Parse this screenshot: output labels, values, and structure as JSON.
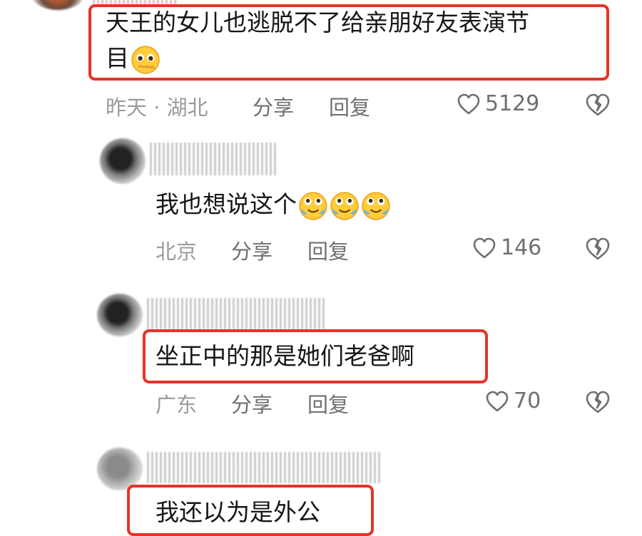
{
  "comments": [
    {
      "text_line1": "天王的女儿也逃脱不了给亲朋好友表演节",
      "text_line2": "目",
      "location": "昨天 · 湖北",
      "share": "分享",
      "reply": "回复",
      "likes": "5129",
      "emoji": "pleading-face-icon"
    },
    {
      "text": "我也想说这个",
      "location": "北京",
      "share": "分享",
      "reply": "回复",
      "likes": "146",
      "emoji": "laughing-crying-face-icon"
    },
    {
      "text": "坐正中的那是她们老爸啊",
      "location": "广东",
      "share": "分享",
      "reply": "回复",
      "likes": "70"
    },
    {
      "text": "我还以为是外公"
    }
  ],
  "colors": {
    "highlight": "#e63327",
    "meta": "#9b9b9b",
    "action": "#6f6f6f"
  }
}
